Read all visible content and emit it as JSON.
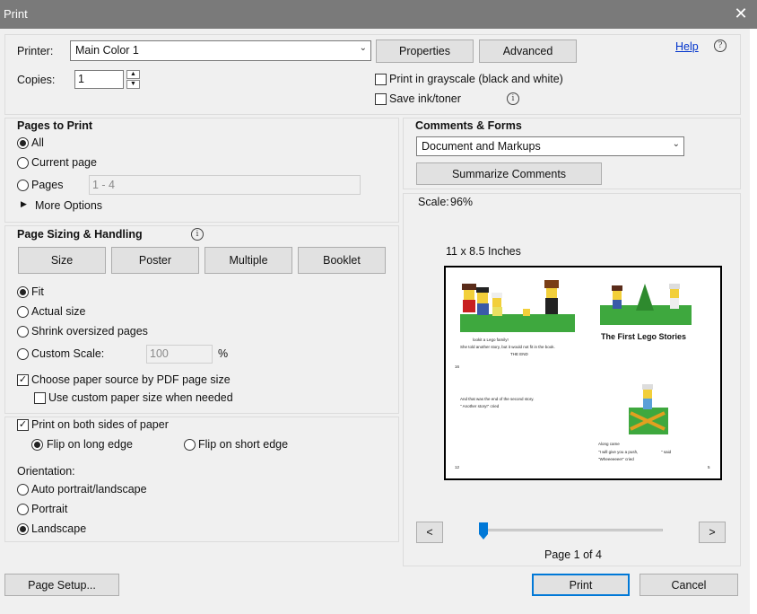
{
  "window": {
    "title": "Print",
    "close_glyph": "✕"
  },
  "printer": {
    "label": "Printer:",
    "value": "Main Color 1",
    "properties_label": "Properties",
    "advanced_label": "Advanced",
    "help_label": "Help",
    "copies_label": "Copies:",
    "copies_value": "1",
    "grayscale_label": "Print in grayscale (black and white)",
    "grayscale_checked": false,
    "save_ink_label": "Save ink/toner",
    "save_ink_checked": false
  },
  "pages_to_print": {
    "title": "Pages to Print",
    "all_label": "All",
    "current_label": "Current page",
    "pages_label": "Pages",
    "pages_value": "1 - 4",
    "more_options_label": "More Options",
    "selected": "All"
  },
  "sizing": {
    "title": "Page Sizing & Handling",
    "tabs": [
      "Size",
      "Poster",
      "Multiple",
      "Booklet"
    ],
    "fit_label": "Fit",
    "actual_label": "Actual size",
    "shrink_label": "Shrink oversized pages",
    "custom_label": "Custom Scale:",
    "custom_value": "100",
    "percent": "%",
    "selected": "Fit",
    "paper_source_label": "Choose paper source by PDF page size",
    "paper_source_checked": true,
    "custom_paper_label": "Use custom paper size when needed",
    "custom_paper_checked": false
  },
  "duplex": {
    "both_sides_label": "Print on both sides of paper",
    "both_sides_checked": true,
    "long_edge_label": "Flip on long edge",
    "short_edge_label": "Flip on short edge",
    "selected": "long"
  },
  "orientation": {
    "title": "Orientation:",
    "auto_label": "Auto portrait/landscape",
    "portrait_label": "Portrait",
    "landscape_label": "Landscape",
    "selected": "Landscape"
  },
  "comments": {
    "title": "Comments & Forms",
    "value": "Document and Markups",
    "summarize_label": "Summarize Comments"
  },
  "preview": {
    "scale_label": "Scale:",
    "scale_value": "96%",
    "paper_label": "11 x 8.5 Inches",
    "book_title": "The First Lego Stories",
    "page_text": "Page 1 of 4",
    "prev_label": "<",
    "next_label": ">",
    "current_page": 1,
    "total_pages": 4,
    "snippet1": "lookit a Lego family!",
    "snippet2": "She told another story, but it would not fit in the book.",
    "snippet3": "THE END",
    "snippet4": "And that was the end of the second story.",
    "snippet5": "\" Another story!\" cried",
    "snippet6": "Along came",
    "snippet7": "\"I will give you a push,",
    "snippet8": "\" said",
    "snippet9": "\"Wheeeeeee!\" cried",
    "num_left_top": "16",
    "num_left_bottom": "12",
    "num_right_bottom": "5"
  },
  "footer": {
    "page_setup_label": "Page Setup...",
    "print_label": "Print",
    "cancel_label": "Cancel"
  },
  "colors": {
    "accent": "#0078d7",
    "title_bar": "#7a7a7a"
  }
}
